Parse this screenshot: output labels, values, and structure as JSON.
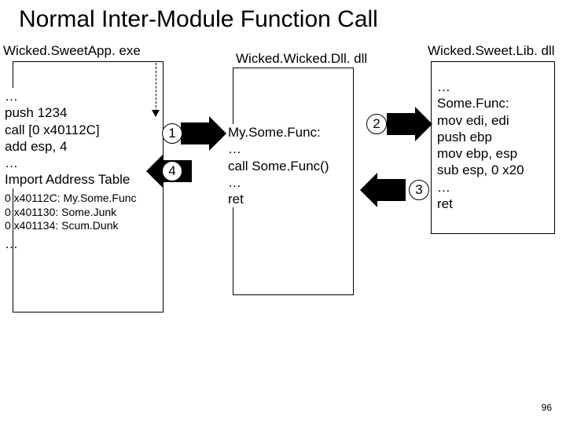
{
  "title": "Normal Inter-Module Function Call",
  "slide_number": "96",
  "modules": {
    "app": {
      "label": "Wicked.SweetApp. exe"
    },
    "dll": {
      "label": "Wicked.Wicked.Dll. dll"
    },
    "lib": {
      "label": "Wicked.Sweet.Lib. dll"
    }
  },
  "code": {
    "app_main": "…\npush 1234\ncall [0 x40112C]\nadd esp, 4\n…\nImport Address Table",
    "app_iat": "0 x40112C: My.Some.Func\n0 x401130: Some.Junk\n0 x401134: Scum.Dunk",
    "app_tail": "…",
    "dll_body": "My.Some.Func:\n…\ncall Some.Func()\n…\nret",
    "lib_body": "…\nSome.Func:\nmov edi, edi\npush ebp\nmov ebp, esp\nsub esp, 0 x20\n…\nret"
  },
  "steps": {
    "s1": "1",
    "s2": "2",
    "s3": "3",
    "s4": "4"
  }
}
